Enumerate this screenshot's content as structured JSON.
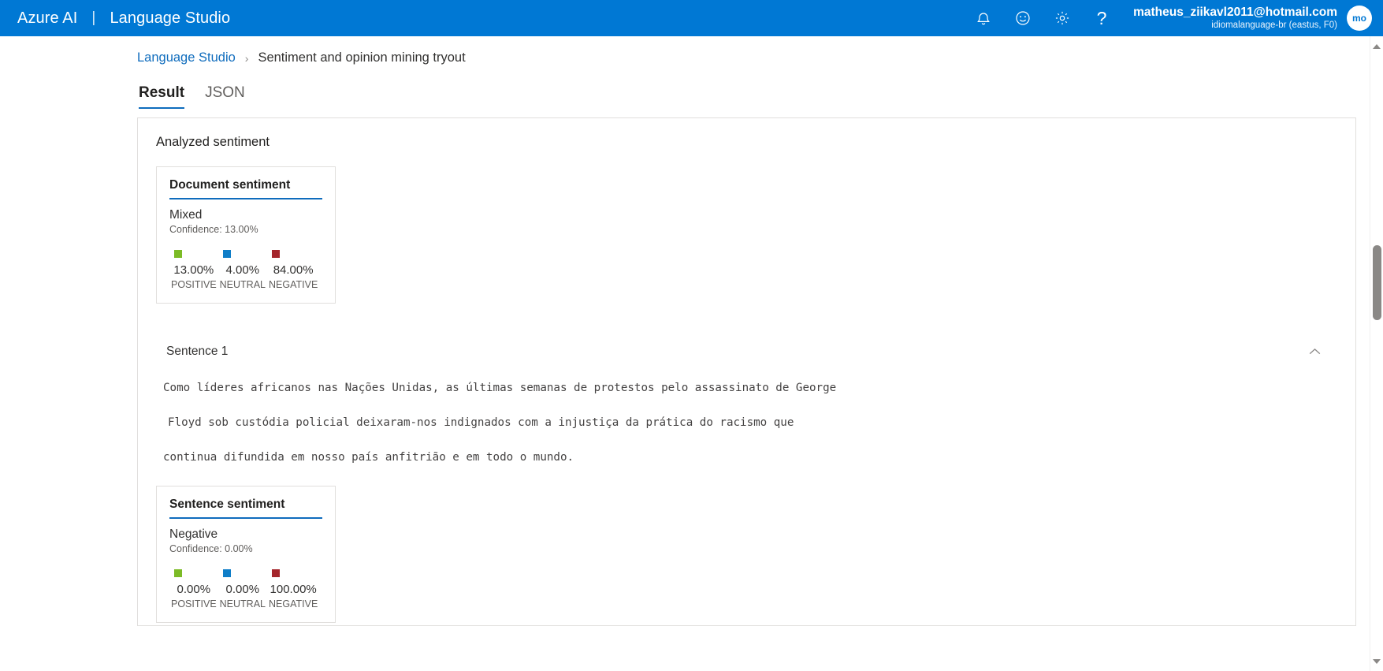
{
  "topbar": {
    "brand": "Azure AI",
    "separator": "|",
    "product": "Language Studio",
    "icons": [
      {
        "name": "notification-bell-icon"
      },
      {
        "name": "feedback-smiley-icon"
      },
      {
        "name": "settings-gear-icon"
      }
    ],
    "help_glyph": "?",
    "account": {
      "email": "matheus_ziikavl2011@hotmail.com",
      "resource": "idiomalanguage-br (eastus, F0)",
      "avatar_initials": "mo"
    }
  },
  "breadcrumb": {
    "root": "Language Studio",
    "separator": "›",
    "current": "Sentiment and opinion mining tryout"
  },
  "tabs": [
    {
      "label": "Result",
      "active": true
    },
    {
      "label": "JSON",
      "active": false
    }
  ],
  "panel": {
    "title": "Analyzed sentiment"
  },
  "document_sentiment": {
    "heading": "Document sentiment",
    "verdict": "Mixed",
    "confidence": "Confidence: 13.00%",
    "legend": [
      {
        "name": "POSITIVE",
        "value": "13.00%",
        "color": "#7CBB26"
      },
      {
        "name": "NEUTRAL",
        "value": "4.00%",
        "color": "#0F7EC8"
      },
      {
        "name": "NEGATIVE",
        "value": "84.00%",
        "color": "#A4262C"
      }
    ]
  },
  "sentence": {
    "title": "Sentence 1",
    "collapse_icon": "chevron-up-icon",
    "lines": [
      "Como líderes africanos nas Nações Unidas, as últimas semanas de protestos pelo assassinato de George",
      "Floyd sob custódia policial deixaram-nos indignados com a injustiça da prática do racismo que",
      "continua difundida em nosso país anfitrião e em todo o mundo."
    ]
  },
  "sentence_sentiment": {
    "heading": "Sentence sentiment",
    "verdict": "Negative",
    "confidence": "Confidence: 0.00%",
    "legend": [
      {
        "name": "POSITIVE",
        "value": "0.00%",
        "color": "#7CBB26"
      },
      {
        "name": "NEUTRAL",
        "value": "0.00%",
        "color": "#0F7EC8"
      },
      {
        "name": "NEGATIVE",
        "value": "100.00%",
        "color": "#A4262C"
      }
    ]
  },
  "colors": {
    "brand_blue": "#0078D4",
    "accent_blue": "#0F6CBD",
    "positive": "#7CBB26",
    "neutral": "#0F7EC8",
    "negative": "#A4262C"
  }
}
